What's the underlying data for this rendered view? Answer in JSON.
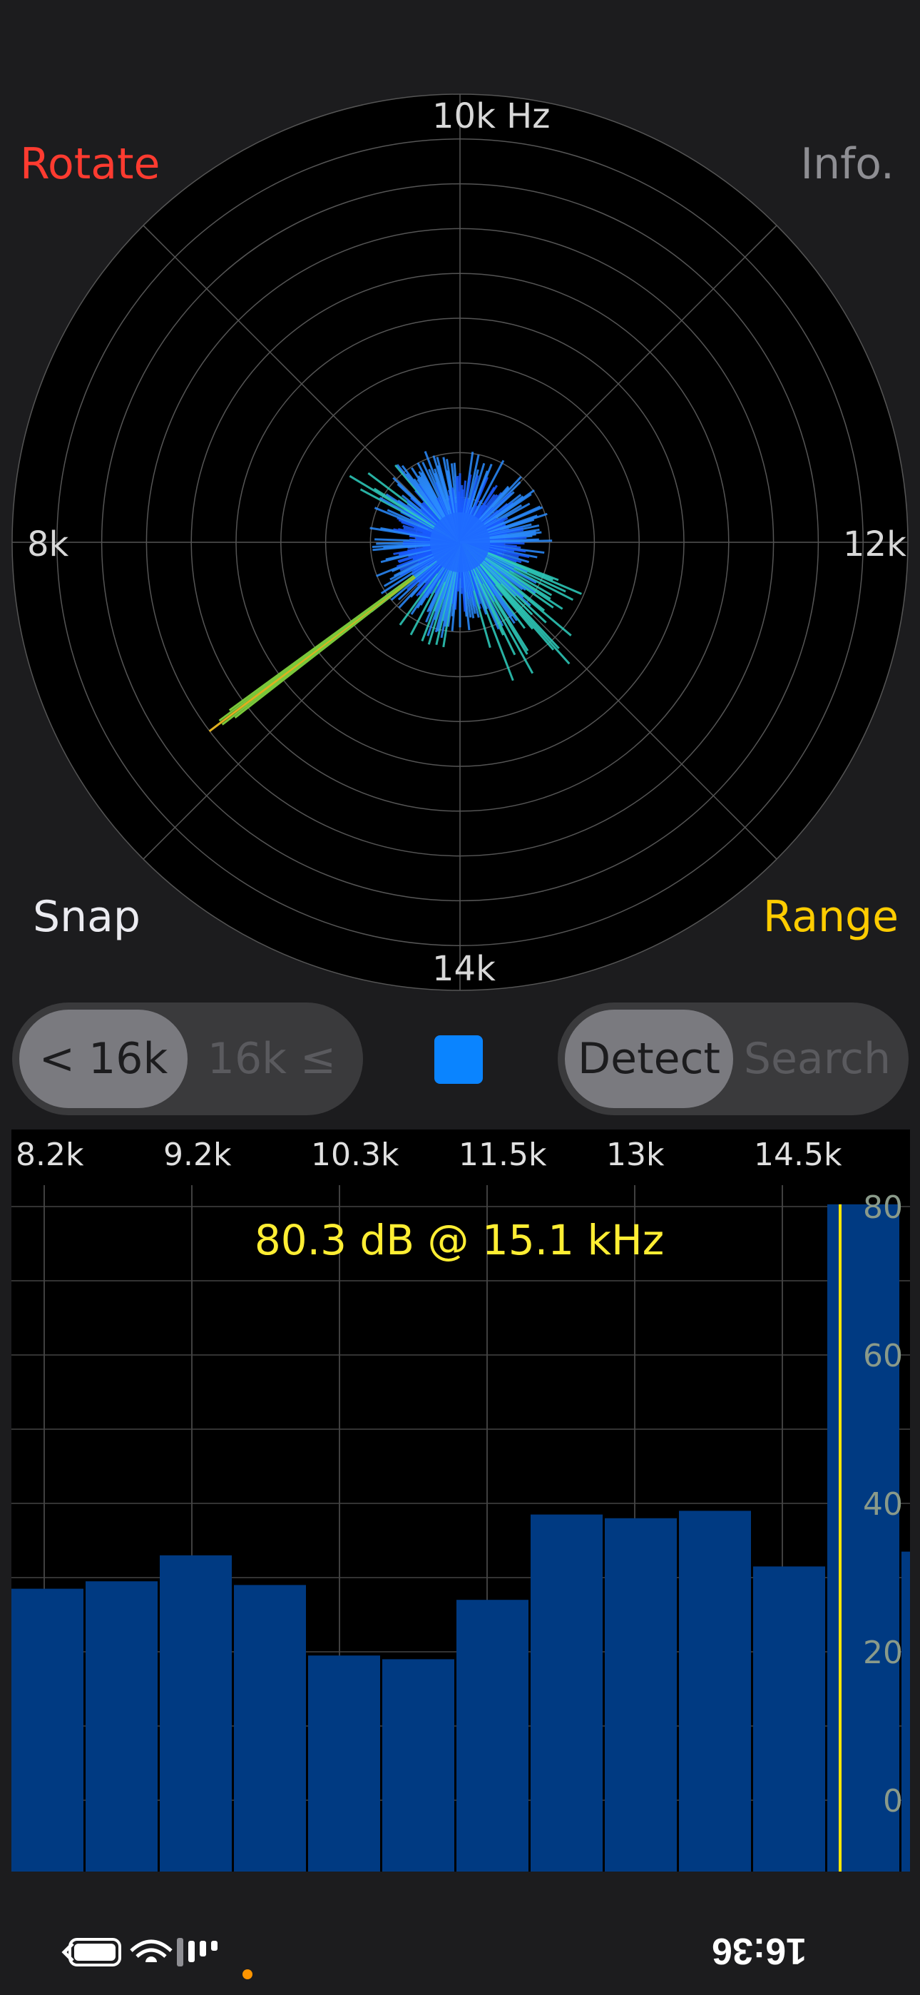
{
  "corner_buttons": {
    "rotate": "Rotate",
    "info": "Info.",
    "snap": "Snap",
    "range": "Range"
  },
  "polar": {
    "top_label": "10k Hz",
    "left_label": "8k",
    "right_label": "12k",
    "bottom_label": "14k",
    "ring_count": 10,
    "spoke_count": 8
  },
  "range_segment": {
    "options": [
      "< 16k",
      "16k ≤"
    ],
    "selected": "< 16k"
  },
  "mode_segment": {
    "options": [
      "Detect",
      "Search"
    ],
    "selected": "Detect"
  },
  "colors": {
    "accent_red": "#ff3b30",
    "accent_yellow": "#ffcc00",
    "indicator_blue": "#0a84ff",
    "bar_blue": "#003a82"
  },
  "chart_data": {
    "type": "bar",
    "x_tick_labels": [
      "8.2k",
      "9.2k",
      "10.3k",
      "11.5k",
      "13k",
      "14.5k"
    ],
    "y_tick_labels": [
      "80",
      "60",
      "40",
      "20",
      "0"
    ],
    "ylim": [
      -10,
      80
    ],
    "readout": "80.3 dB @ 15.1 kHz",
    "values": [
      28.5,
      29.5,
      33,
      29,
      19.5,
      19,
      27,
      38.5,
      38,
      39,
      31.5,
      80.3,
      33.5
    ],
    "peak_index": 11
  },
  "status_bar": {
    "time": "16:36"
  }
}
